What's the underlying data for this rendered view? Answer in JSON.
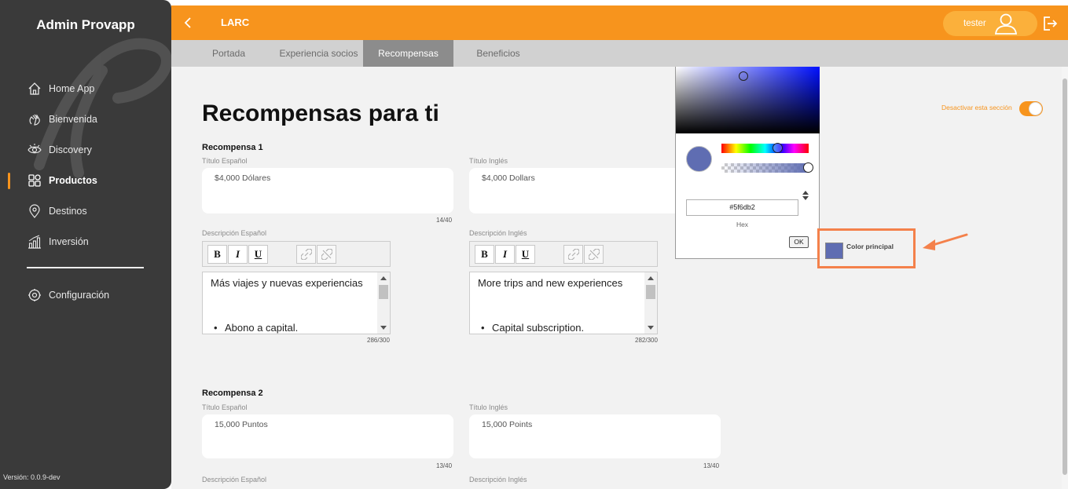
{
  "app": {
    "brand": "Admin Provapp",
    "version": "Versión: 0.0.9-dev"
  },
  "sidebar": {
    "items": [
      {
        "label": "Home App",
        "icon": "home-icon"
      },
      {
        "label": "Bienvenida",
        "icon": "wave-hand-icon"
      },
      {
        "label": "Discovery",
        "icon": "eye-icon"
      },
      {
        "label": "Productos",
        "icon": "grid-icon",
        "active": true
      },
      {
        "label": "Destinos",
        "icon": "map-pin-icon"
      },
      {
        "label": "Inversión",
        "icon": "bar-chart-icon"
      }
    ],
    "settings": {
      "label": "Configuración",
      "icon": "gear-icon"
    }
  },
  "header": {
    "title": "LARC",
    "user": "tester"
  },
  "tabs": [
    {
      "label": "Portada"
    },
    {
      "label": "Experiencia socios"
    },
    {
      "label": "Recompensas",
      "active": true
    },
    {
      "label": "Beneficios"
    }
  ],
  "page": {
    "title": "Recompensas para ti",
    "toggle_label": "Desactivar esta sección",
    "toggle_on": true
  },
  "rewards": [
    {
      "title": "Recompensa 1",
      "title_es_label": "Título Español",
      "title_es": "$4,000 Dólares",
      "title_es_count": "14/40",
      "title_en_label": "Título Inglés",
      "title_en": "$4,000 Dollars",
      "desc_es_label": "Descripción Español",
      "desc_es_text": "Más viajes y nuevas experiencias",
      "desc_es_bullet": "Abono a capital.",
      "desc_es_count": "286/300",
      "desc_en_label": "Descripción Inglés",
      "desc_en_text": "More trips and new experiences",
      "desc_en_bullet": "Capital subscription.",
      "desc_en_count": "282/300"
    },
    {
      "title": "Recompensa 2",
      "title_es_label": "Título Español",
      "title_es": "15,000 Puntos",
      "title_es_count": "13/40",
      "title_en_label": "Título Inglés",
      "title_en": "15,000 Points",
      "title_en_count": "13/40",
      "desc_es_label": "Descripción Español",
      "desc_en_label": "Descripción Inglés"
    }
  ],
  "toolbar": {
    "bold": "B",
    "italic": "I",
    "underline": "U"
  },
  "color_picker": {
    "hex": "#5f6db2",
    "hex_label": "Hex",
    "ok_label": "OK",
    "selected_color": "#5f6db2"
  },
  "color_control": {
    "label": "Color principal",
    "color": "#5f6db2"
  },
  "colors": {
    "accent": "#f7941d",
    "sidebar": "#3a3a3a",
    "highlight": "#f4814b"
  }
}
